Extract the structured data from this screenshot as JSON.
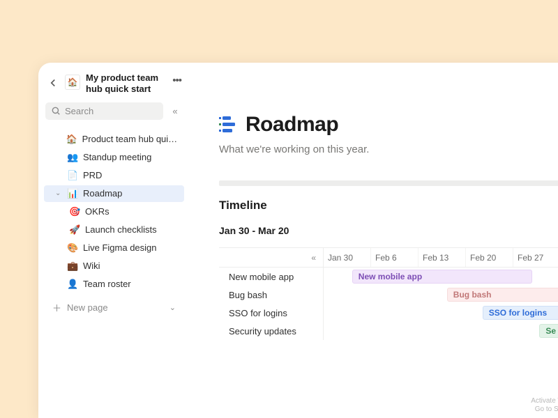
{
  "workspace": {
    "title": "My product team hub quick start",
    "icon": "🏠"
  },
  "search": {
    "placeholder": "Search"
  },
  "sidebar": {
    "items": [
      {
        "icon": "🏠",
        "label": "Product team hub quick st...",
        "level": 1
      },
      {
        "icon": "👥",
        "label": "Standup meeting",
        "level": 1
      },
      {
        "icon": "📄",
        "label": "PRD",
        "level": 1
      },
      {
        "icon": "📊",
        "label": "Roadmap",
        "level": 1,
        "selected": true,
        "expanded": true
      },
      {
        "icon": "🎯",
        "label": "OKRs",
        "level": 2
      },
      {
        "icon": "🚀",
        "label": "Launch checklists",
        "level": 2
      },
      {
        "icon": "🎨",
        "label": "Live Figma design",
        "level": 1
      },
      {
        "icon": "💼",
        "label": "Wiki",
        "level": 1
      },
      {
        "icon": "👤",
        "label": "Team roster",
        "level": 1
      }
    ],
    "new_page": "New page"
  },
  "page": {
    "title": "Roadmap",
    "subtitle": "What we're working on this year."
  },
  "timeline": {
    "title": "Timeline",
    "range": "Jan 30 - Mar 20",
    "columns": [
      "Jan 30",
      "Feb 6",
      "Feb 13",
      "Feb 20",
      "Feb 27"
    ],
    "tasks": [
      {
        "name": "New mobile app",
        "bar_label": "New mobile app",
        "color": "purple",
        "start_col": 0.6,
        "span": 3.8
      },
      {
        "name": "Bug bash",
        "bar_label": "Bug bash",
        "color": "pink",
        "start_col": 2.6,
        "span": 2.6,
        "avatar": true
      },
      {
        "name": "SSO for logins",
        "bar_label": "SSO for logins",
        "color": "blue",
        "start_col": 3.35,
        "span": 2.2
      },
      {
        "name": "Security updates",
        "bar_label": "Se",
        "color": "green",
        "start_col": 4.55,
        "span": 0.8
      }
    ]
  },
  "watermark": {
    "line1": "Activate W",
    "line2": "Go to Set"
  }
}
